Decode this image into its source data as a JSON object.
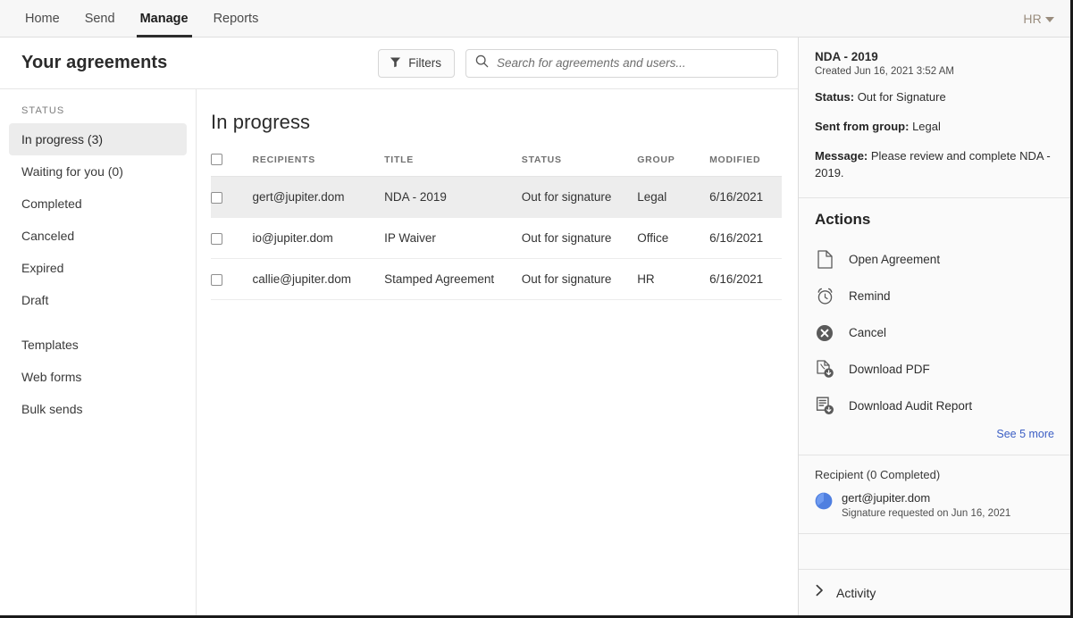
{
  "topnav": {
    "items": [
      {
        "label": "Home",
        "active": false
      },
      {
        "label": "Send",
        "active": false
      },
      {
        "label": "Manage",
        "active": true
      },
      {
        "label": "Reports",
        "active": false
      }
    ],
    "user_initials": "HR",
    "caret_icon": "chevron-down-icon"
  },
  "header": {
    "title": "Your agreements",
    "filters_label": "Filters",
    "filters_icon": "funnel-icon",
    "search_icon": "search-icon",
    "search_value": "",
    "search_placeholder": "Search for agreements and users..."
  },
  "sidebar": {
    "group_label": "STATUS",
    "items": [
      {
        "label": "In progress (3)",
        "selected": true
      },
      {
        "label": "Waiting for you (0)",
        "selected": false
      },
      {
        "label": "Completed",
        "selected": false
      },
      {
        "label": "Canceled",
        "selected": false
      },
      {
        "label": "Expired",
        "selected": false
      },
      {
        "label": "Draft",
        "selected": false
      }
    ],
    "items2": [
      {
        "label": "Templates",
        "selected": false
      },
      {
        "label": "Web forms",
        "selected": false
      },
      {
        "label": "Bulk sends",
        "selected": false
      }
    ]
  },
  "content": {
    "title": "In progress",
    "columns": [
      "RECIPIENTS",
      "TITLE",
      "STATUS",
      "GROUP",
      "MODIFIED"
    ],
    "rows": [
      {
        "recipients": "gert@jupiter.dom",
        "title": "NDA - 2019",
        "status": "Out for signature",
        "group": "Legal",
        "modified": "6/16/2021",
        "selected": true
      },
      {
        "recipients": "io@jupiter.dom",
        "title": "IP Waiver",
        "status": "Out for signature",
        "group": "Office",
        "modified": "6/16/2021",
        "selected": false
      },
      {
        "recipients": "callie@jupiter.dom",
        "title": "Stamped Agreement",
        "status": "Out for signature",
        "group": "HR",
        "modified": "6/16/2021",
        "selected": false
      }
    ]
  },
  "detail": {
    "doc_title": "NDA - 2019",
    "created": "Created Jun 16, 2021 3:52 AM",
    "status_key": "Status:",
    "status_value": "Out for Signature",
    "group_key": "Sent from group:",
    "group_value": "Legal",
    "message_key": "Message:",
    "message_value": "Please review and complete NDA - 2019.",
    "actions_heading": "Actions",
    "actions": [
      {
        "label": "Open Agreement",
        "icon": "document-icon"
      },
      {
        "label": "Remind",
        "icon": "alarm-clock-icon"
      },
      {
        "label": "Cancel",
        "icon": "cancel-circle-icon"
      },
      {
        "label": "Download PDF",
        "icon": "download-pdf-icon"
      },
      {
        "label": "Download Audit Report",
        "icon": "download-audit-icon"
      }
    ],
    "see_more": "See 5 more",
    "recipient_heading": "Recipient (0 Completed)",
    "recipient_email": "gert@jupiter.dom",
    "recipient_status": "Signature requested on Jun 16, 2021",
    "recipient_avatar_icon": "pie-progress-avatar-icon",
    "activity_label": "Activity",
    "activity_icon": "chevron-right-icon"
  },
  "colors": {
    "accent_link": "#3b5ec4",
    "user_text": "#9a8d7e",
    "selected_row": "#ededed",
    "selected_sidebar": "#ececec",
    "panel_bg": "#fafafa"
  }
}
